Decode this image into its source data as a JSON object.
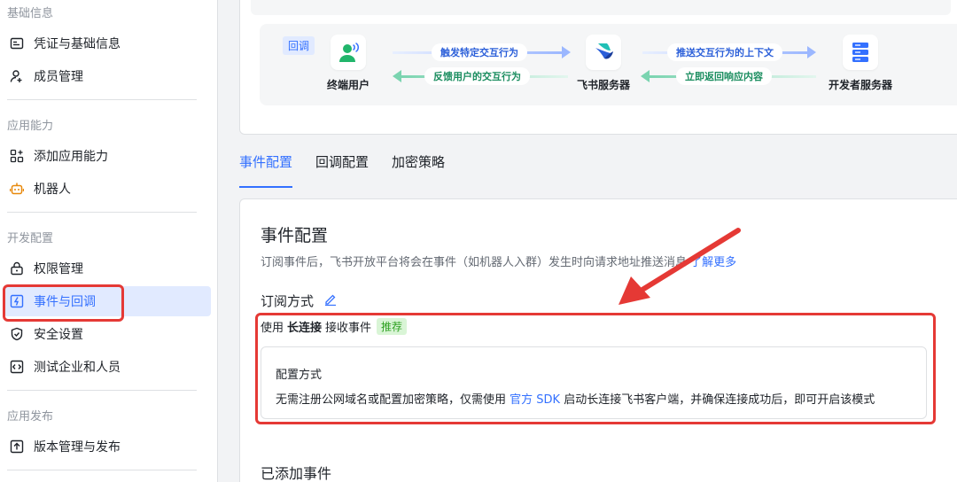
{
  "sidebar": {
    "sections": [
      {
        "title": "基础信息"
      },
      {
        "title": "应用能力"
      },
      {
        "title": "开发配置"
      },
      {
        "title": "应用发布"
      }
    ],
    "items": [
      {
        "label": "凭证与基础信息",
        "icon": "credential-icon"
      },
      {
        "label": "成员管理",
        "icon": "add-user-icon"
      },
      {
        "label": "添加应用能力",
        "icon": "apps-plus-icon"
      },
      {
        "label": "机器人",
        "icon": "robot-icon"
      },
      {
        "label": "权限管理",
        "icon": "lock-icon"
      },
      {
        "label": "事件与回调",
        "icon": "event-icon",
        "active": true
      },
      {
        "label": "安全设置",
        "icon": "shield-icon"
      },
      {
        "label": "测试企业和人员",
        "icon": "code-icon"
      },
      {
        "label": "版本管理与发布",
        "icon": "upload-icon"
      }
    ]
  },
  "flow": {
    "tag": "回调",
    "nodes": [
      "终端用户",
      "飞书服务器",
      "开发者服务器"
    ],
    "arrows": [
      "触发特定交互行为",
      "反馈用户的交互行为",
      "推送交互行为的上下文",
      "立即返回响应内容"
    ]
  },
  "tabs": [
    "事件配置",
    "回调配置",
    "加密策略"
  ],
  "content": {
    "title": "事件配置",
    "desc": "订阅事件后，飞书开放平台将会在事件（如机器人入群）发生时向请求地址推送消息",
    "desc_link": "了解更多",
    "subscribe_label": "订阅方式",
    "mode_prefix": "使用",
    "mode_bold": "长连接",
    "mode_suffix": "接收事件",
    "recommend_badge": "推荐",
    "cfg_title": "配置方式",
    "cfg_desc_prefix": "无需注册公网域名或配置加密策略，仅需使用",
    "cfg_desc_link": "官方 SDK",
    "cfg_desc_suffix": "启动长连接飞书客户端，并确保连接成功后，即可开启该模式",
    "added_title": "已添加事件"
  },
  "colors": {
    "accent": "#3370ff",
    "highlight": "#e53935",
    "recommend": "#2ea121"
  }
}
